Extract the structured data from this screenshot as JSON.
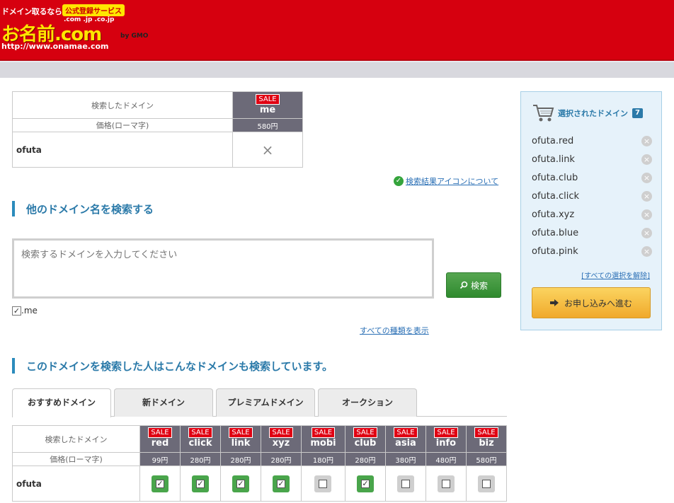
{
  "header": {
    "tagline": "ドメイン取るなら",
    "badge": "公式登録サービス",
    "tlds": ".com .jp .co.jp",
    "brand": "お名前.com",
    "by": "by GMO",
    "url": "http://www.onamae.com"
  },
  "result": {
    "label_searched": "検索したドメイン",
    "label_price": "価格(ローマ字)",
    "sale": "SALE",
    "tld": "me",
    "price": "580円",
    "name": "ofuta",
    "status": "×"
  },
  "icon_help_link": "検索結果アイコンについて",
  "search_section": {
    "title": "他のドメイン名を検索する",
    "placeholder": "検索するドメインを入力してください",
    "button": "検索",
    "me_label": ".me",
    "show_all": "すべての種類を表示"
  },
  "related_section": {
    "title": "このドメインを検索した人はこんなドメインも検索しています。",
    "tabs": [
      "おすすめドメイン",
      "新ドメイン",
      "プレミアムドメイン",
      "オークション"
    ],
    "label_searched": "検索したドメイン",
    "label_price": "価格(ローマ字)",
    "sale": "SALE",
    "name": "ofuta",
    "tlds": [
      "red",
      "click",
      "link",
      "xyz",
      "mobi",
      "club",
      "asia",
      "info",
      "biz"
    ],
    "prices": [
      "99円",
      "280円",
      "280円",
      "280円",
      "180円",
      "280円",
      "380円",
      "480円",
      "580円"
    ],
    "checked": [
      true,
      true,
      true,
      true,
      false,
      true,
      false,
      false,
      false
    ]
  },
  "sidebar": {
    "title": "選択されたドメイン",
    "count": "7",
    "items": [
      "ofuta.red",
      "ofuta.link",
      "ofuta.club",
      "ofuta.click",
      "ofuta.xyz",
      "ofuta.blue",
      "ofuta.pink"
    ],
    "clear_all": "[すべての選択を解除]",
    "apply": "お申し込みへ進む"
  }
}
